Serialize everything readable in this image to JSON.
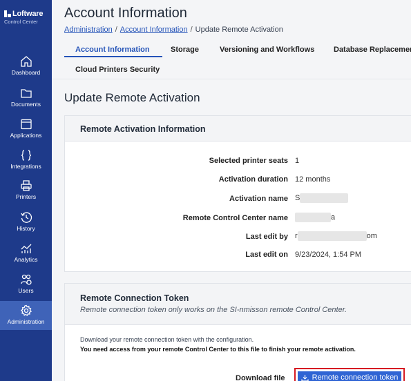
{
  "app": {
    "brand": "Loftware",
    "brand_sub": "Control Center"
  },
  "sidebar": {
    "items": [
      {
        "label": "Dashboard",
        "icon": "home-icon"
      },
      {
        "label": "Documents",
        "icon": "folder-icon"
      },
      {
        "label": "Applications",
        "icon": "window-icon"
      },
      {
        "label": "Integrations",
        "icon": "braces-icon"
      },
      {
        "label": "Printers",
        "icon": "printer-icon"
      },
      {
        "label": "History",
        "icon": "history-icon"
      },
      {
        "label": "Analytics",
        "icon": "analytics-icon"
      },
      {
        "label": "Users",
        "icon": "users-icon"
      },
      {
        "label": "Administration",
        "icon": "gear-icon",
        "active": true
      }
    ]
  },
  "header": {
    "title": "Account Information",
    "breadcrumb": [
      "Administration",
      "Account Information",
      "Update Remote Activation"
    ]
  },
  "tabs": [
    "Account Information",
    "Storage",
    "Versioning and Workflows",
    "Database Replacement",
    "Cloud Printers Security"
  ],
  "page": {
    "section_title": "Update Remote Activation"
  },
  "activation_card": {
    "title": "Remote Activation Information",
    "rows": [
      {
        "label": "Selected printer seats",
        "value": "1"
      },
      {
        "label": "Activation duration",
        "value": "12 months"
      },
      {
        "label": "Activation name",
        "value": "S"
      },
      {
        "label": "Remote Control Center name",
        "value": "a"
      },
      {
        "label": "Last edit by",
        "value": "r",
        "suffix": "om"
      },
      {
        "label": "Last edit on",
        "value": "9/23/2024, 1:54 PM"
      }
    ]
  },
  "token_card": {
    "title": "Remote Connection Token",
    "note": "Remote connection token only works on the SI-nmisson remote Control Center.",
    "instruction": "Download your remote connection token with the configuration.",
    "instruction_strong": "You need access from your remote Control Center to this file to finish your remote activation.",
    "download_label": "Download file",
    "button_label": "Remote connection token"
  },
  "colors": {
    "sidebar_bg": "#1e3a8a",
    "sidebar_active": "#3f63b8",
    "accent": "#2453b8",
    "button": "#2f64d4",
    "highlight": "#d61a22"
  }
}
